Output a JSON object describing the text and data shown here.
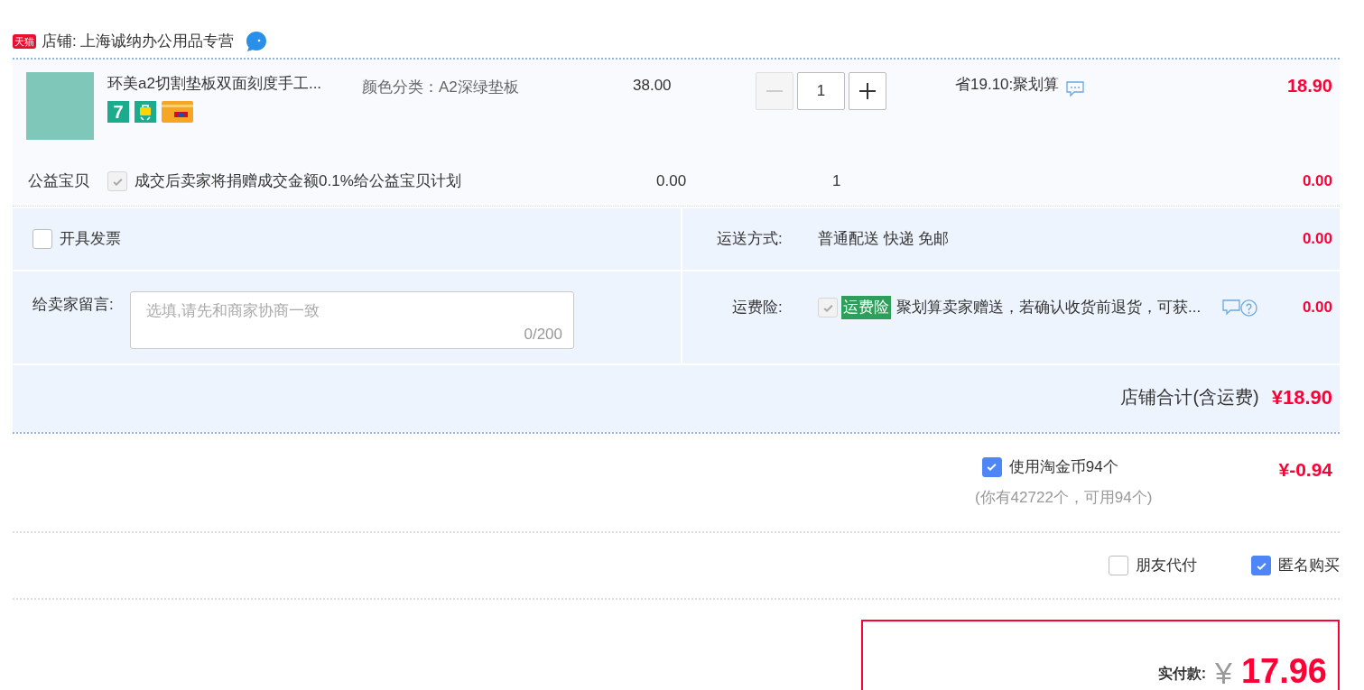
{
  "shop": {
    "badge": "天猫",
    "label": "店铺: 上海诚纳办公用品专营"
  },
  "item": {
    "title": "环美a2切割垫板双面刻度手工...",
    "sku": "颜色分类：A2深绿垫板",
    "seven_day_badge": "7",
    "price": "38.00",
    "quantity": "1",
    "minus_disabled": true,
    "promo": "省19.10:聚划算",
    "subtotal": "18.90"
  },
  "charity": {
    "label": "公益宝贝",
    "checked": true,
    "disabled": true,
    "text": "成交后卖家将捐赠成交金额0.1%给公益宝贝计划",
    "price": "0.00",
    "quantity": "1",
    "subtotal": "0.00"
  },
  "invoice": {
    "label": "开具发票",
    "checked": false
  },
  "shipping": {
    "label": "运送方式:",
    "value": "普通配送 快递 免邮",
    "cost": "0.00"
  },
  "message": {
    "label": "给卖家留言:",
    "placeholder": "选填,请先和商家协商一致",
    "counter": "0/200"
  },
  "insurance": {
    "label": "运费险:",
    "checked": true,
    "disabled": true,
    "tag": "运费险",
    "text": "聚划算卖家赠送，若确认收货前退货，可获...",
    "cost": "0.00"
  },
  "shop_total": {
    "label": "店铺合计(含运费)",
    "amount": "¥18.90"
  },
  "coins": {
    "checked": true,
    "label": "使用淘金币94个",
    "note": "(你有42722个，可用94个)",
    "amount": "¥-0.94"
  },
  "options": [
    {
      "label": "朋友代付",
      "checked": false
    },
    {
      "label": "匿名购买",
      "checked": true
    }
  ],
  "payment": {
    "label": "实付款:",
    "currency": "¥",
    "amount": "17.96"
  }
}
